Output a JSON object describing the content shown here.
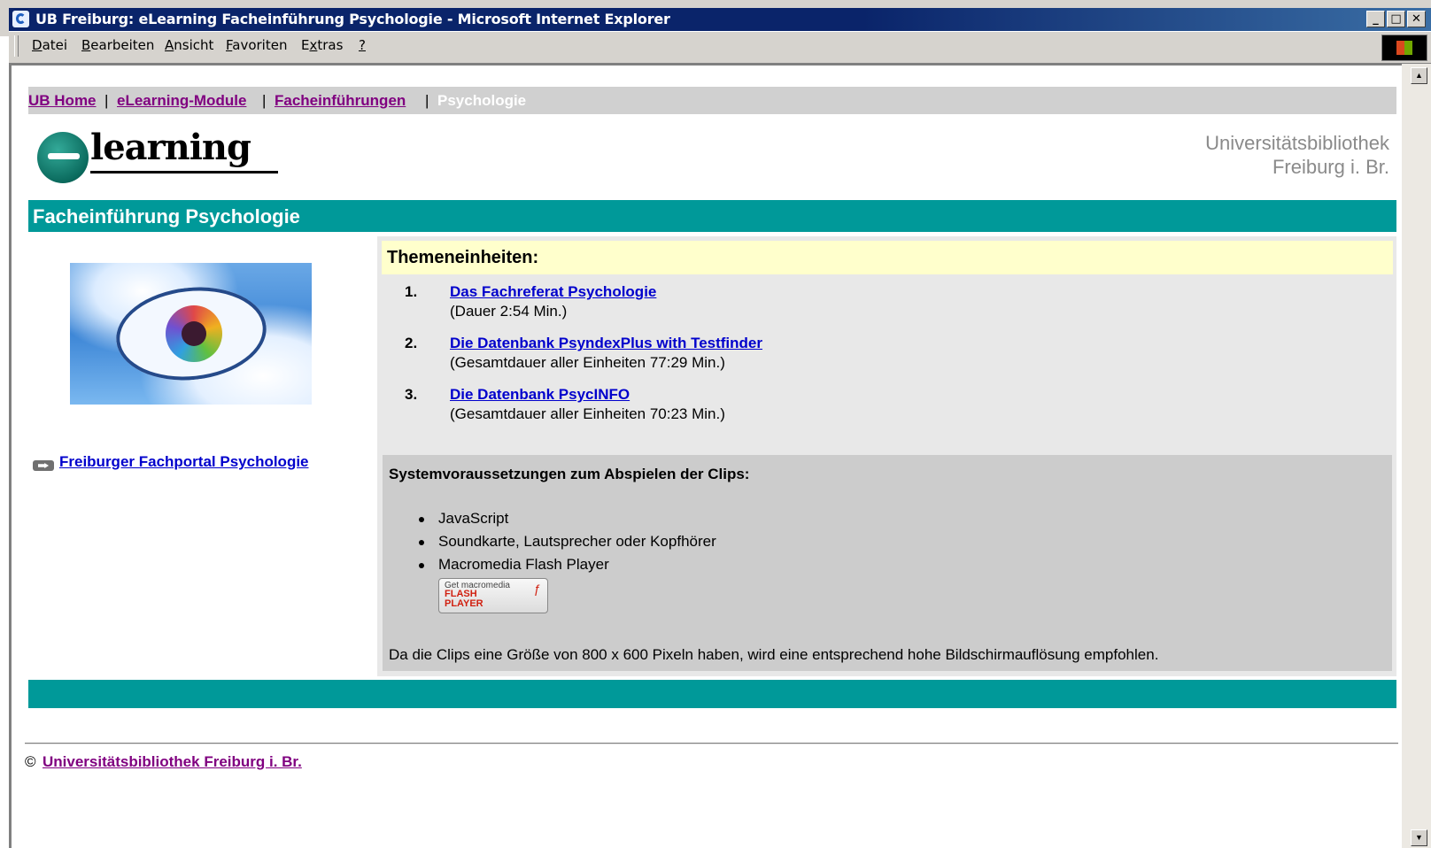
{
  "window": {
    "title": "UB Freiburg: eLearning Facheinführung Psychologie - Microsoft Internet Explorer",
    "buttons": {
      "minimize": "_",
      "maximize": "□",
      "close": "✕"
    }
  },
  "menubar": {
    "items": [
      {
        "label": "Datei",
        "key": "D"
      },
      {
        "label": "Bearbeiten",
        "key": "B"
      },
      {
        "label": "Ansicht",
        "key": "A"
      },
      {
        "label": "Favoriten",
        "key": "F"
      },
      {
        "label": "Extras",
        "key": "x"
      },
      {
        "label": "?",
        "key": "?"
      }
    ]
  },
  "breadcrumb": {
    "links": [
      "UB Home",
      "eLearning-Module",
      "Facheinführungen"
    ],
    "separator": "|",
    "current": "Psychologie"
  },
  "logo": {
    "text": "learning"
  },
  "institution": {
    "line1": "Universitätsbibliothek",
    "line2": "Freiburg i. Br."
  },
  "page_title": "Facheinführung Psychologie",
  "sidebar": {
    "link": "Freiburger Fachportal Psychologie"
  },
  "themen": {
    "heading": "Themeneinheiten:",
    "items": [
      {
        "num": "1.",
        "title": "Das Fachreferat Psychologie",
        "duration": "(Dauer 2:54 Min.)"
      },
      {
        "num": "2.",
        "title": "Die Datenbank PsyndexPlus with Testfinder",
        "duration": "(Gesamtdauer aller Einheiten 77:29 Min.)"
      },
      {
        "num": "3.",
        "title": "Die Datenbank PsycINFO",
        "duration": "(Gesamtdauer aller Einheiten 70:23 Min.)"
      }
    ]
  },
  "system": {
    "heading": "Systemvoraussetzungen zum Abspielen der Clips:",
    "items": [
      "JavaScript",
      "Soundkarte, Lautsprecher oder Kopfhörer",
      "Macromedia Flash Player"
    ],
    "flash_badge": {
      "small": "Get macromedia",
      "line1": "FLASH",
      "line2": "PLAYER"
    },
    "note": "Da die Clips eine Größe von 800 x 600 Pixeln haben, wird eine entsprechend hohe Bildschirmauflösung empfohlen."
  },
  "footer": {
    "copyright_symbol": "©",
    "link": "Universitätsbibliothek Freiburg i. Br."
  },
  "colors": {
    "teal": "#009999",
    "title_bar": "#0a246a",
    "link_visited": "#800080",
    "link": "#0000cc",
    "highlight": "#ffffcc"
  }
}
